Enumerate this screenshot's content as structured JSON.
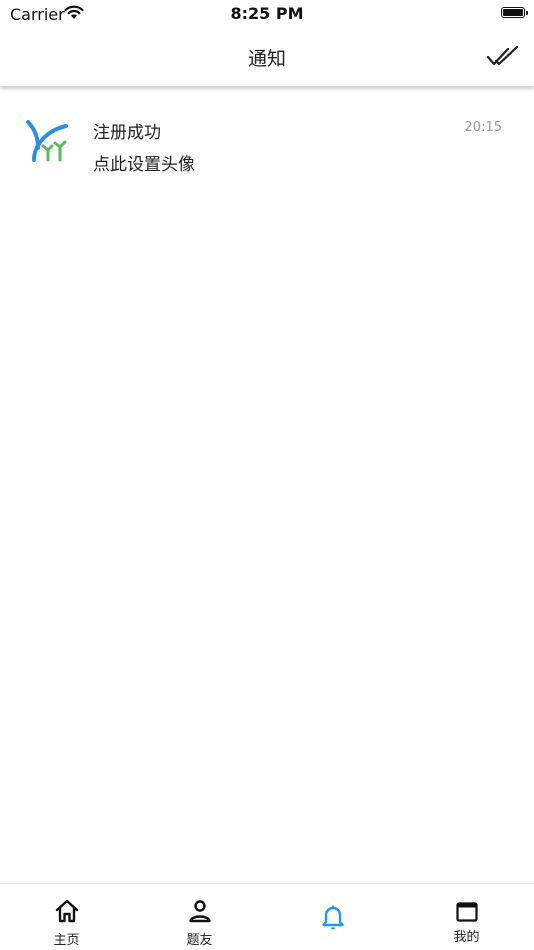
{
  "status_bar": {
    "carrier": "Carrier",
    "time": "8:25 PM"
  },
  "header": {
    "title": "通知",
    "mark_all_read_icon": "double-check-icon"
  },
  "notifications": [
    {
      "title": "注册成功",
      "body": "点此设置头像",
      "time": "20:15",
      "icon": "app-logo-icon"
    }
  ],
  "tabs": [
    {
      "label": "主页",
      "icon": "home-icon",
      "active": false
    },
    {
      "label": "题友",
      "icon": "person-icon",
      "active": false
    },
    {
      "label": "",
      "icon": "bell-icon",
      "active": true
    },
    {
      "label": "我的",
      "icon": "window-icon",
      "active": false
    }
  ],
  "colors": {
    "accent": "#2196f3",
    "logo_blue": "#2b8fe0",
    "logo_green": "#5cb85c",
    "text": "#222222",
    "muted": "#9a9a9a"
  }
}
